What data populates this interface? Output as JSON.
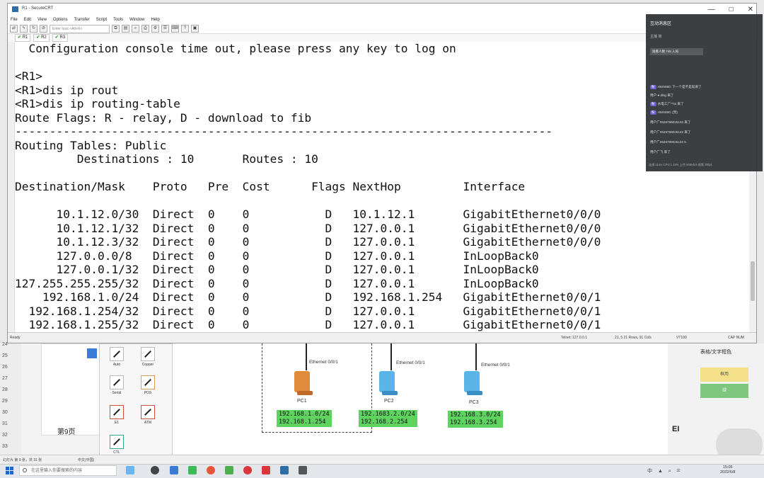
{
  "window": {
    "title": "R1 - SecureCRT",
    "controls": [
      "—",
      "□",
      "✕"
    ],
    "menu": [
      "File",
      "Edit",
      "View",
      "Options",
      "Transfer",
      "Script",
      "Tools",
      "Window",
      "Help"
    ],
    "toolbar_host_placeholder": "Enter host <Alt+R>",
    "tabs": [
      "R1",
      "R2",
      "R3"
    ]
  },
  "terminal": {
    "lines": [
      "  Configuration console time out, please press any key to log on",
      "",
      "<R1>",
      "<R1>dis ip rout",
      "<R1>dis ip routing-table",
      "Route Flags: R - relay, D - download to fib",
      "------------------------------------------------------------------------------",
      "Routing Tables: Public",
      "         Destinations : 10       Routes : 10",
      "",
      "Destination/Mask    Proto   Pre  Cost      Flags NextHop         Interface",
      "",
      "      10.1.12.0/30  Direct  0    0           D   10.1.12.1       GigabitEthernet0/0/0",
      "      10.1.12.1/32  Direct  0    0           D   127.0.0.1       GigabitEthernet0/0/0",
      "      10.1.12.3/32  Direct  0    0           D   127.0.0.1       GigabitEthernet0/0/0",
      "      127.0.0.0/8   Direct  0    0           D   127.0.0.1       InLoopBack0",
      "      127.0.0.1/32  Direct  0    0           D   127.0.0.1       InLoopBack0",
      "127.255.255.255/32  Direct  0    0           D   127.0.0.1       InLoopBack0",
      "    192.168.1.0/24  Direct  0    0           D   192.168.1.254   GigabitEthernet0/0/1",
      "  192.168.1.254/32  Direct  0    0           D   127.0.0.1       GigabitEthernet0/0/1",
      "  192.168.1.255/32  Direct  0    0           D   127.0.0.1       GigabitEthernet0/0/1"
    ]
  },
  "status": {
    "left": "Ready",
    "connection": "Telnet: 127.0.0.1",
    "cursor": "21,  5   21 Rows, 91 Cols",
    "terminal_type": "VT100",
    "caps": "CAP  NUM"
  },
  "ensp": {
    "row_numbers": [
      "24",
      "25",
      "26",
      "27",
      "28",
      "29",
      "30",
      "31",
      "32",
      "33"
    ],
    "page_label": "第9页",
    "palette": [
      "Auto",
      "Copper",
      "Serial",
      "POS",
      "E1",
      "ATM",
      "CTL"
    ],
    "pcs": [
      {
        "name": "PC1",
        "iface": "Ethernet 0/0/1",
        "net": "192.168.1.0/24",
        "gw": "192.168.1.254",
        "color": "#e08a3c"
      },
      {
        "name": "PC2",
        "iface": "Ethernet 0/0/1",
        "net": "192.1683.2.0/24",
        "gw": "192.168.2.254",
        "color": "#5ab4e6"
      },
      {
        "name": "PC3",
        "iface": "Ethernet 0/0/1",
        "net": "192.168.3.0/24",
        "gw": "192.168.3.254",
        "color": "#5ab4e6"
      }
    ],
    "right_title": "表格/文字框色",
    "right_button_yellow": "框用",
    "right_button_green": "绿",
    "right_label": "EI",
    "bottom_left": "幻灯片 第 9 张，共 31 张",
    "bottom_lang": "中文(中国)"
  },
  "chat": {
    "title": "互动消息区",
    "subtitle": "主播  简",
    "pinned": "观看人数 745  入局",
    "messages": [
      "HMH690: 下一个是不是就来了",
      "用户 ● dlsg 来了",
      "水电工广**ss 来了",
      "HMH690: (赞)",
      "用户广0626799025132 来了",
      "用户广0626799025132 来了",
      "用户广0626799025132 5",
      "用户广飞 来了"
    ],
    "footer": "连接 11ms   CPU 1.15%   上传 500Kb/s   视频 30fps"
  },
  "taskbar": {
    "search_placeholder": "在这里输入你要搜索的内容",
    "tray": "中 ▲ ⌕ ✉",
    "time": "15:05",
    "date": "2022/6/8"
  }
}
